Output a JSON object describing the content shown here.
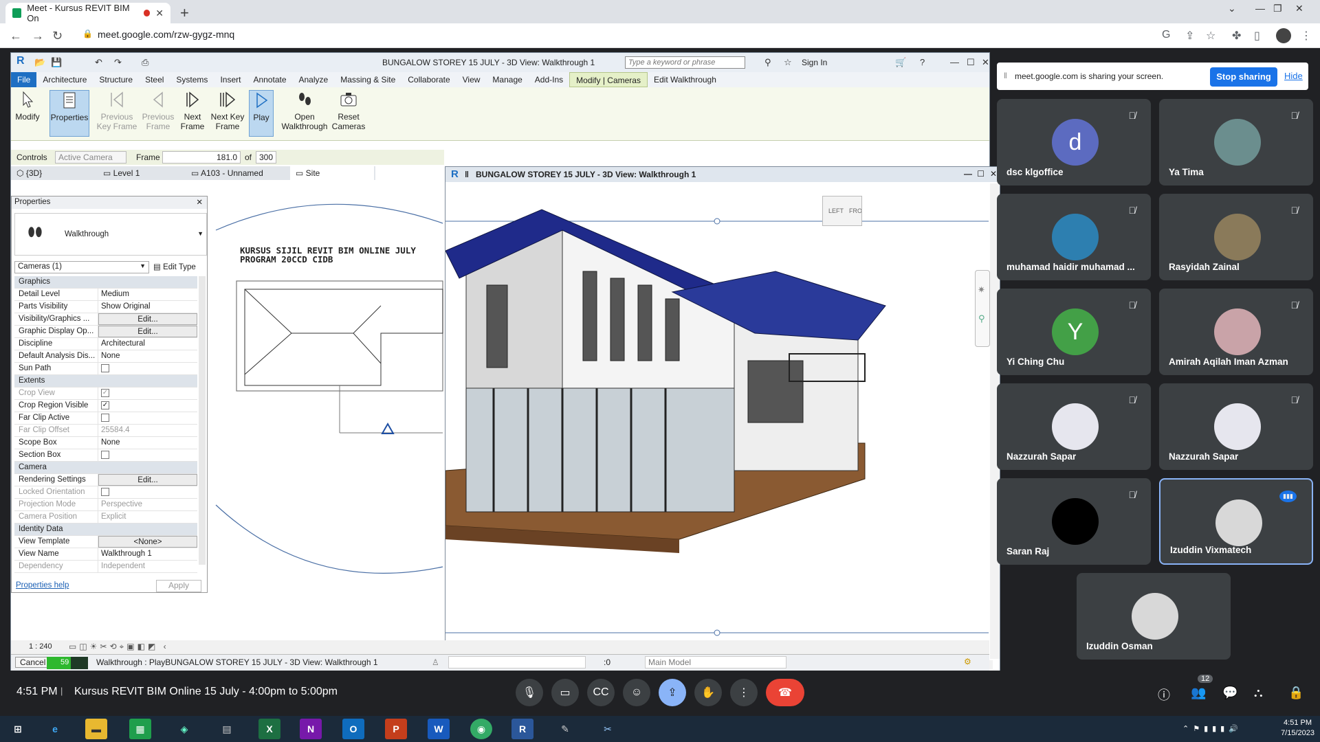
{
  "browser": {
    "tab_title": "Meet - Kursus REVIT BIM On",
    "url": "meet.google.com/rzw-gygz-mnq"
  },
  "revit": {
    "title": "BUNGALOW STOREY 15 JULY - 3D View: Walkthrough 1",
    "search_placeholder": "Type a keyword or phrase",
    "sign_in": "Sign In",
    "menu": [
      "File",
      "Architecture",
      "Structure",
      "Steel",
      "Systems",
      "Insert",
      "Annotate",
      "Analyze",
      "Massing & Site",
      "Collaborate",
      "View",
      "Manage",
      "Add-Ins",
      "Modify | Cameras",
      "Edit Walkthrough"
    ],
    "ribbon": {
      "modify": "Modify",
      "properties": "Properties",
      "prev_key": "Previous Key Frame",
      "prev_frame": "Previous Frame",
      "next_frame": "Next Frame",
      "next_key": "Next Key Frame",
      "play": "Play",
      "open_walk": "Open Walkthrough",
      "reset_cam": "Reset Cameras"
    },
    "options": {
      "controls_label": "Controls",
      "controls_value": "Active Camera",
      "frame_label": "Frame",
      "frame_value": "181.0",
      "of_label": "of",
      "total": "300"
    },
    "view_tabs": [
      "{3D}",
      "Level 1",
      "A103 - Unnamed",
      "Site"
    ],
    "properties": {
      "header": "Properties",
      "type_name": "Walkthrough",
      "camera_selector": "Cameras (1)",
      "edit_type": "Edit Type",
      "rows": [
        {
          "k": "Graphics",
          "sec": true
        },
        {
          "k": "Detail Level",
          "v": "Medium"
        },
        {
          "k": "Parts Visibility",
          "v": "Show Original"
        },
        {
          "k": "Visibility/Graphics ...",
          "v": "Edit...",
          "btn": true
        },
        {
          "k": "Graphic Display Op...",
          "v": "Edit...",
          "btn": true
        },
        {
          "k": "Discipline",
          "v": "Architectural"
        },
        {
          "k": "Default Analysis Dis...",
          "v": "None"
        },
        {
          "k": "Sun Path",
          "cb": "off"
        },
        {
          "k": "Extents",
          "sec": true
        },
        {
          "k": "Crop View",
          "cb": "on",
          "dim": true
        },
        {
          "k": "Crop Region Visible",
          "cb": "on"
        },
        {
          "k": "Far Clip Active",
          "cb": "off"
        },
        {
          "k": "Far Clip Offset",
          "v": "25584.4",
          "dim": true
        },
        {
          "k": "Scope Box",
          "v": "None"
        },
        {
          "k": "Section Box",
          "cb": "off"
        },
        {
          "k": "Camera",
          "sec": true
        },
        {
          "k": "Rendering Settings",
          "v": "Edit...",
          "btn": true
        },
        {
          "k": "Locked Orientation",
          "cb": "off",
          "dim": true
        },
        {
          "k": "Projection Mode",
          "v": "Perspective",
          "dim": true
        },
        {
          "k": "Camera Position",
          "v": "Explicit",
          "dim": true
        },
        {
          "k": "Identity Data",
          "sec": true
        },
        {
          "k": "View Template",
          "v": "<None>",
          "btn": true
        },
        {
          "k": "View Name",
          "v": "Walkthrough 1"
        },
        {
          "k": "Dependency",
          "v": "Independent",
          "dim": true
        }
      ],
      "help": "Properties help",
      "apply": "Apply"
    },
    "plan_title": "KURSUS SIJIL REVIT BIM ONLINE JULY PROGRAM 20CCD CIDB",
    "viewcube": {
      "left": "LEFT",
      "front": "FRONT"
    },
    "scale": "1 : 240",
    "status": {
      "cancel": "Cancel",
      "progress_text": "59",
      "progress_pct": 59,
      "message": "Walkthrough : PlayBUNGALOW STOREY 15 JULY - 3D View: Walkthrough 1",
      "selection_count": ":0",
      "model": "Main Model"
    }
  },
  "meet": {
    "share_text": "meet.google.com is sharing your screen.",
    "stop_sharing": "Stop sharing",
    "hide": "Hide",
    "participants": [
      {
        "name": "dsc klgoffice",
        "initial": "d",
        "color": "#5c6bc0"
      },
      {
        "name": "Ya Tima",
        "initial": "",
        "color": "#6b8e8e"
      },
      {
        "name": "muhamad haidir muhamad ...",
        "initial": "",
        "color": "#2d7fb0"
      },
      {
        "name": "Rasyidah Zainal",
        "initial": "",
        "color": "#8a7a5a"
      },
      {
        "name": "Yi Ching Chu",
        "initial": "Y",
        "color": "#43a047"
      },
      {
        "name": "Amirah Aqilah Iman Azman",
        "initial": "",
        "color": "#c9a3a8"
      },
      {
        "name": "Nazzurah Sapar",
        "initial": "",
        "color": "#e6e6ee"
      },
      {
        "name": "Nazzurah Sapar",
        "initial": "",
        "color": "#e6e6ee"
      },
      {
        "name": "Saran Raj",
        "initial": "",
        "color": "#000000"
      },
      {
        "name": "Izuddin Vixmatech",
        "initial": "",
        "color": "#d8d8d8"
      },
      {
        "name": "Izuddin Osman",
        "initial": "",
        "color": "#d8d8d8"
      }
    ],
    "time": "4:51 PM",
    "meeting_title": "Kursus REVIT BIM Online 15 July - 4:00pm to 5:00pm",
    "people_count": "12"
  },
  "taskbar": {
    "clock_time": "4:51 PM",
    "clock_date": "7/15/2023"
  }
}
